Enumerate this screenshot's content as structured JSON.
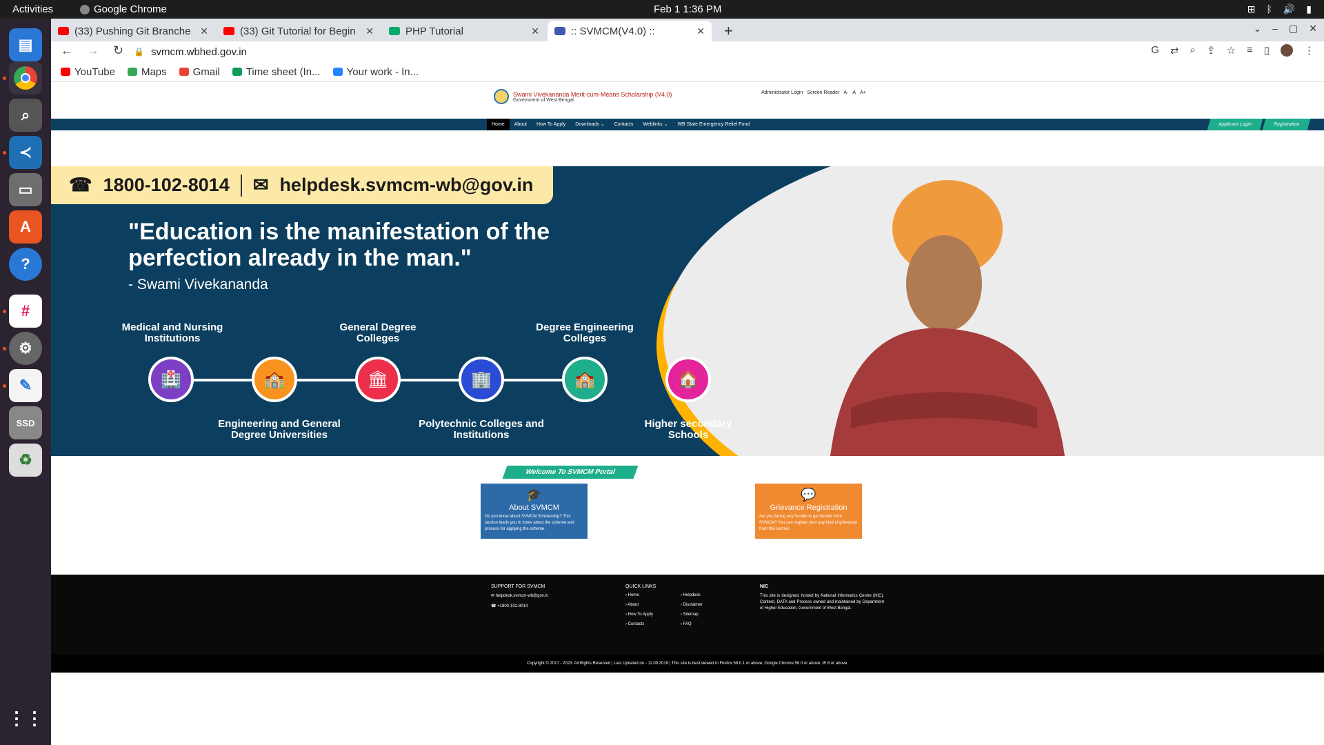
{
  "system": {
    "activities": "Activities",
    "app_name": "Google Chrome",
    "clock": "Feb 1  1:36 PM"
  },
  "tabs": [
    {
      "title": "(33) Pushing Git Branche",
      "favicon_color": "#ff0000"
    },
    {
      "title": "(33) Git Tutorial for Begin",
      "favicon_color": "#ff0000"
    },
    {
      "title": "PHP Tutorial",
      "favicon_color": "#04aa6d"
    },
    {
      "title": ":: SVMCM(V4.0) ::",
      "favicon_color": "#3b5bab",
      "active": true
    }
  ],
  "address": "svmcm.wbhed.gov.in",
  "bookmarks": [
    {
      "label": "YouTube",
      "color": "#ff0000"
    },
    {
      "label": "Maps",
      "color": "#34a853"
    },
    {
      "label": "Gmail",
      "color": "#ea4335"
    },
    {
      "label": "Time sheet (In...",
      "color": "#0f9d58"
    },
    {
      "label": "Your work - In...",
      "color": "#2684ff"
    }
  ],
  "site": {
    "logo_title": "Swami Vivekananda Merit-cum-Means Scholarship (V4.0)",
    "logo_subtitle": "Government of West Bengal",
    "utility": [
      "Administrator Login",
      "Screen Reader",
      "A-",
      "A",
      "A+"
    ],
    "nav": [
      "Home",
      "About",
      "How To Apply",
      "Downloads ⌄",
      "Contacts",
      "Weblinks ⌄",
      "WB State Emergency Relief Fund"
    ],
    "nav_right": [
      "Applicant Login",
      "Registration"
    ]
  },
  "hero": {
    "phone": "1800-102-8014",
    "email": "helpdesk.svmcm-wb@gov.in",
    "quote": "\"Education is the manifestation of the perfection already in the man.\"",
    "author": "- Swami Vivekananda",
    "categories": [
      {
        "label": "Medical and Nursing Institutions",
        "color": "#7c3fc4",
        "pos": "top"
      },
      {
        "label": "Engineering and General Degree Universities",
        "color": "#f7931e",
        "pos": "bottom"
      },
      {
        "label": "General Degree Colleges",
        "color": "#ec2f4b",
        "pos": "top"
      },
      {
        "label": "Polytechnic Colleges and Institutions",
        "color": "#2a4bd3",
        "pos": "bottom"
      },
      {
        "label": "Degree Engineering Colleges",
        "color": "#1fae8b",
        "pos": "top"
      },
      {
        "label": "Higher secondary Schools",
        "color": "#e3249b",
        "pos": "bottom"
      }
    ]
  },
  "welcome": "Welcome To SVMCM Portal",
  "cards": [
    {
      "title": "About SVMCM",
      "desc": "Do you know about SVMCM Scholarship? This section leads you to know about the scheme and process for applying the scheme.",
      "color": "#2d6aa8"
    },
    {
      "title": "Grievance Registration",
      "desc": "Are you facing any trouble to get benefit from SVMCM? You can register your any kind of grievance from this section.",
      "color": "#f08a30"
    }
  ],
  "footer": {
    "support_heading": "SUPPORT FOR SVMCM",
    "support_email": "helpdesk.svmcm-wb@gov.in",
    "support_phone": "+1800-102-8014",
    "quick_heading": "QUICK LINKS",
    "quick_col1": [
      "Home",
      "About",
      "How To Apply",
      "Contacts"
    ],
    "quick_col2": [
      "Helpdesk",
      "Disclaimer",
      "Sitemap",
      "FAQ"
    ],
    "nic_logo": "NIC",
    "nic_text": "This site is designed, hosted by National Informatics Centre (NIC). Content, DATA and Process owned and maintained by Department of Higher Education, Government of West Bengal.",
    "copyright": "Copyright © 2017 - 2023. All Rights Reserved |  Last Updated on - 11.09.2019 | This site is best viewed in Firefox 58.0.1 or above, Google Chrome 58.0 or above, IE 8 or above."
  }
}
